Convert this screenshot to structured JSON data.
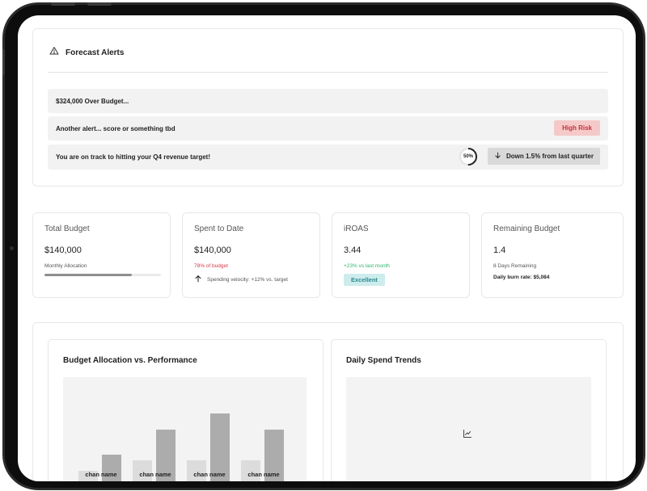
{
  "alerts": {
    "title": "Forecast Alerts",
    "items": [
      {
        "text": "$324,000 Over Budget..."
      },
      {
        "text": "Another alert... score or something tbd",
        "badge": "High Risk"
      },
      {
        "text": "You are on track to hitting your Q4 revenue target!",
        "progress_label": "50%",
        "progress_value": 0.5,
        "trend": "Down 1.5% from last quarter"
      }
    ]
  },
  "metrics": {
    "total_budget": {
      "title": "Total Budget",
      "value": "$140,000",
      "sub": "Monthly Allocation",
      "progress": 0.75
    },
    "spent": {
      "title": "Spent to Date",
      "value": "$140,000",
      "sub": "78% of budget",
      "velocity": "Spending velocity: +12% vs. target"
    },
    "iroas": {
      "title": "iROAS",
      "value": "3.44",
      "sub": "+23% vs last month",
      "badge": "Excellent"
    },
    "remaining": {
      "title": "Remaining Budget",
      "value": "1.4",
      "sub": "8 Days Remaining",
      "burn": "Daily burn rate: $5,084"
    }
  },
  "chart_data": {
    "type": "bar",
    "title": "Budget Allocation vs. Performance",
    "categories": [
      "chan name",
      "chan name",
      "chan name",
      "chan name"
    ],
    "series": [
      {
        "values": [
          22,
          35,
          35,
          35
        ]
      },
      {
        "values": [
          42,
          73,
          93,
          73
        ]
      }
    ],
    "ylim": [
      0,
      100
    ]
  },
  "trends": {
    "title": "Daily Spend Trends",
    "icon": "line-chart-icon"
  },
  "colors": {
    "risk_bg": "#f6c9c9",
    "risk_text": "#c0343b",
    "excellent_bg": "#cdeced",
    "excellent_text": "#2c8a8e",
    "red": "#d6364b",
    "green": "#2db36b",
    "bar_light": "#dcdcdc",
    "bar_dark": "#acacac"
  }
}
